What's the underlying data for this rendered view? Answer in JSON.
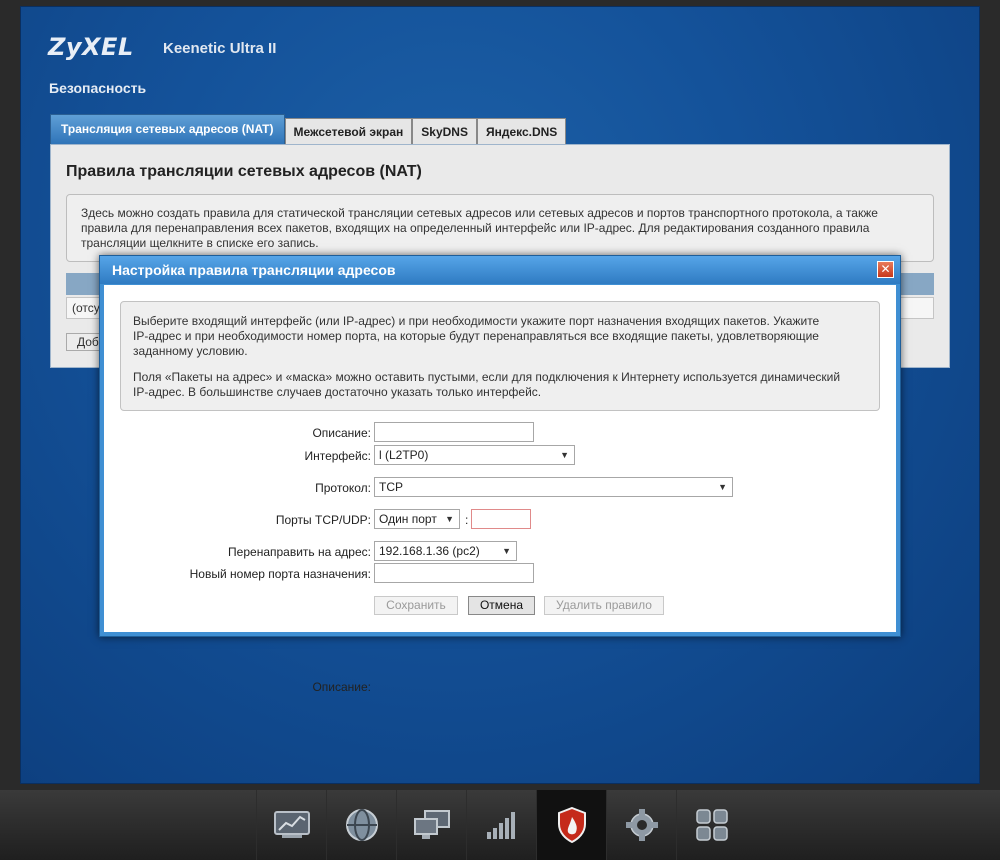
{
  "brand": {
    "logo": "ZyXEL",
    "model": "Keenetic Ultra II"
  },
  "page": {
    "section_title": "Безопасность"
  },
  "tabs": [
    {
      "label": "Трансляция сетевых адресов (NAT)",
      "active": true
    },
    {
      "label": "Межсетевой экран",
      "active": false
    },
    {
      "label": "SkyDNS",
      "active": false
    },
    {
      "label": "Яндекс.DNS",
      "active": false
    }
  ],
  "content": {
    "title": "Правила трансляции сетевых адресов (NAT)",
    "info_line1": "Здесь можно создать правила для статической трансляции сетевых адресов или сетевых адресов и портов транспортного протокола, а также",
    "info_line2": "правила для перенаправления всех пакетов, входящих на определенный интерфейс или IP-адрес. Для редактирования созданного правила",
    "info_line3": "трансляции щелкните в списке его запись.",
    "empty_row": "(отсу",
    "add_button": "Доб"
  },
  "dialog": {
    "title": "Настройка правила трансляции адресов",
    "close_label": "✕",
    "info_p1_l1": "Выберите входящий интерфейс (или IP-адрес) и при необходимости укажите порт назначения входящих пакетов. Укажите",
    "info_p1_l2": "IP-адрес и при необходимости номер порта, на которые будут перенаправляться все входящие пакеты, удовлетворяющие",
    "info_p1_l3": "заданному условию.",
    "info_p2_l1": "Поля «Пакеты на адрес» и «маска» можно оставить пустыми, если для подключения к Интернету используется динамический",
    "info_p2_l2": "IP-адрес. В большинстве случаев достаточно указать только интерфейс.",
    "form": {
      "description_label": "Описание:",
      "description_value": "",
      "interface_label": "Интерфейс:",
      "interface_value": "l (L2TP0)",
      "protocol_label": "Протокол:",
      "protocol_value": "TCP",
      "ports_label": "Порты TCP/UDP:",
      "ports_mode_value": "Один порт",
      "ports_colon": ":",
      "port_value": "",
      "redirect_label": "Перенаправить на адрес:",
      "redirect_value": "192.168.1.36 (pc2)",
      "new_port_label": "Новый номер порта назначения:",
      "new_port_value": ""
    },
    "buttons": {
      "save": "Сохранить",
      "cancel": "Отмена",
      "delete": "Удалить правило"
    }
  },
  "taskbar": {
    "items": [
      {
        "icon": "monitor-chart-icon",
        "active": false
      },
      {
        "icon": "globe-icon",
        "active": false
      },
      {
        "icon": "network-computers-icon",
        "active": false
      },
      {
        "icon": "signal-bars-icon",
        "active": false
      },
      {
        "icon": "security-shield-icon",
        "active": true
      },
      {
        "icon": "gear-icon",
        "active": false
      },
      {
        "icon": "apps-grid-icon",
        "active": false
      }
    ]
  }
}
